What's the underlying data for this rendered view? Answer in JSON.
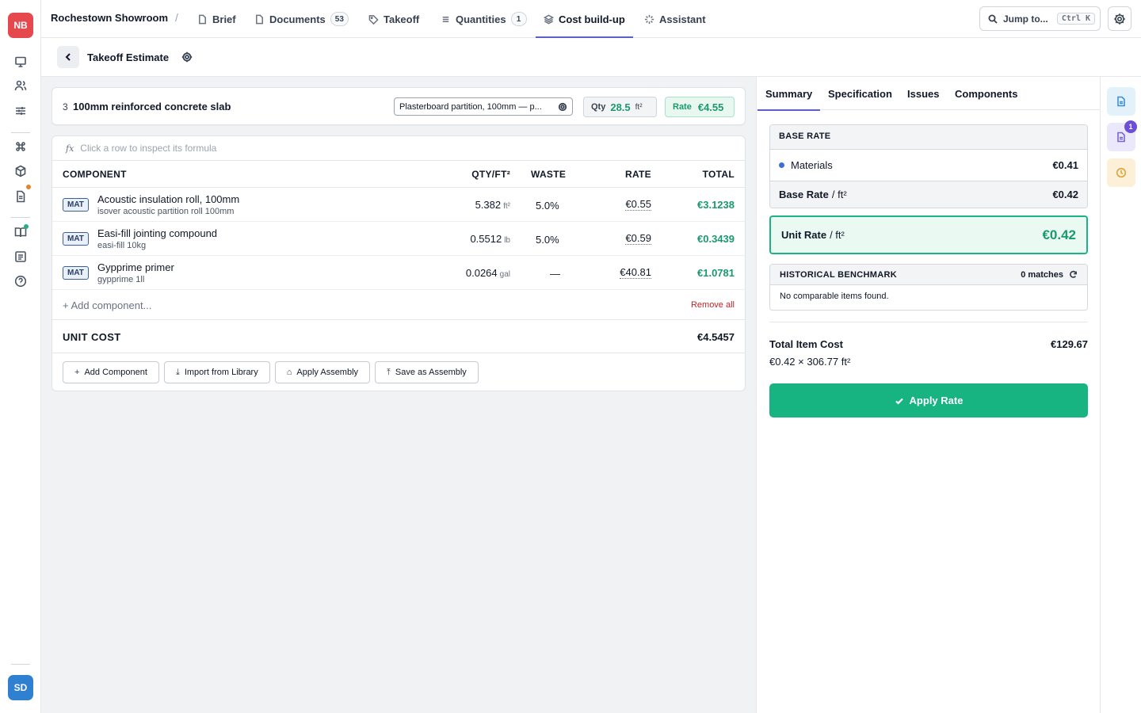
{
  "app": {
    "logo": "NB",
    "user_initials": "SD"
  },
  "rail_icons": [
    "presentation-icon",
    "users-icon",
    "sliders-icon",
    "command-icon",
    "cube-icon",
    "file-icon",
    "book-icon",
    "list-icon",
    "help-icon"
  ],
  "topbar": {
    "project": "Rochestown Showroom",
    "separator": "/",
    "tabs": [
      {
        "label": "Brief",
        "icon": "file-icon"
      },
      {
        "label": "Documents",
        "icon": "file-icon",
        "count": "53"
      },
      {
        "label": "Takeoff",
        "icon": "tag-icon"
      },
      {
        "label": "Quantities",
        "icon": "list-icon",
        "count": "1"
      },
      {
        "label": "Cost build-up",
        "icon": "layers-icon",
        "active": true
      },
      {
        "label": "Assistant",
        "icon": "sparkle-icon"
      }
    ],
    "jump": {
      "label": "Jump to...",
      "shortcut": "Ctrl K"
    }
  },
  "subheader": {
    "title": "Takeoff Estimate"
  },
  "item": {
    "number": "3",
    "name": "100mm reinforced concrete slab",
    "spec": "Plasterboard partition, 100mm — p...",
    "qty_label": "Qty",
    "qty_value": "28.5",
    "qty_unit": "ft²",
    "rate_label": "Rate",
    "rate_value": "€4.55"
  },
  "formula_bar": {
    "fx": "fx",
    "placeholder": "Click a row to inspect its formula"
  },
  "table": {
    "headers": {
      "component": "COMPONENT",
      "qty": "QTY/FT²",
      "waste": "WASTE",
      "rate": "RATE",
      "total": "TOTAL"
    },
    "rows": [
      {
        "type": "MAT",
        "name": "Acoustic insulation roll, 100mm",
        "sub": "isover acoustic partition roll 100mm",
        "qty": "5.382",
        "unit": "ft²",
        "waste": "5.0%",
        "rate": "€0.55",
        "total": "€3.1238"
      },
      {
        "type": "MAT",
        "name": "Easi-fill jointing compound",
        "sub": "easi-fill 10kg",
        "qty": "0.5512",
        "unit": "lb",
        "waste": "5.0%",
        "rate": "€0.59",
        "total": "€0.3439"
      },
      {
        "type": "MAT",
        "name": "Gypprime primer",
        "sub": "gypprime 1ll",
        "qty": "0.0264",
        "unit": "gal",
        "waste": "—",
        "rate": "€40.81",
        "total": "€1.0781"
      }
    ],
    "add_component": "+ Add component...",
    "remove_all": "Remove all",
    "unit_cost_label": "UNIT COST",
    "unit_cost_value": "€4.5457",
    "buttons": [
      {
        "label": "Add Component",
        "glyph": "+"
      },
      {
        "label": "Import from Library",
        "glyph": "⤓"
      },
      {
        "label": "Apply Assembly",
        "glyph": "⌂"
      },
      {
        "label": "Save as Assembly",
        "glyph": "⤒"
      }
    ]
  },
  "panel": {
    "tabs": [
      "Summary",
      "Specification",
      "Issues",
      "Components"
    ],
    "base_rate": {
      "header": "BASE RATE",
      "materials_label": "Materials",
      "materials_value": "€0.41",
      "footer_label": "Base Rate",
      "footer_unit": "/ ft²",
      "footer_value": "€0.42"
    },
    "unit_rate": {
      "label": "Unit Rate",
      "unit": "/ ft²",
      "value": "€0.42"
    },
    "benchmark": {
      "header": "HISTORICAL BENCHMARK",
      "matches": "0 matches",
      "empty": "No comparable items found."
    },
    "total": {
      "label": "Total Item Cost",
      "value": "€129.67",
      "formula": "€0.42 × 306.77 ft²"
    },
    "apply_label": "Apply Rate"
  },
  "strip": {
    "badge": "1"
  },
  "colors": {
    "accent": "#5b5fc7",
    "green": "#17b381",
    "danger": "#c0262d",
    "logo": "#e5484d",
    "avatar": "#2f80d1"
  }
}
